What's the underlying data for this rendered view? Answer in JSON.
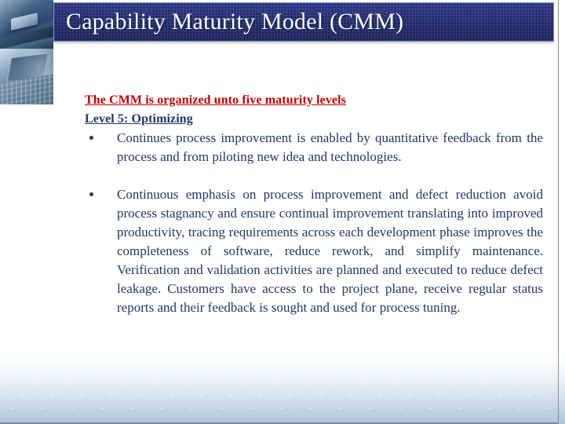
{
  "slide": {
    "title": "Capability Maturity Model (CMM)",
    "title_color": "#FFFFFF",
    "title_bar_color": "#26307A",
    "background_color": "#FFFFFF"
  },
  "content": {
    "lead_heading": "The CMM is organized unto five maturity levels",
    "lead_heading_color": "#C00000",
    "level_heading": "Level 5: Optimizing",
    "level_heading_color": "#1F3864",
    "body_color": "#1F3864",
    "bullets": [
      {
        "marker": "•",
        "text": "Continues process improvement is enabled by quantitative feedback from the process and from piloting new idea and technologies."
      },
      {
        "marker": "•",
        "text": "Continuous emphasis   on process improvement and defect reduction avoid process stagnancy and ensure continual improvement translating into improved productivity, tracing requirements across each development phase improves the completeness of software, reduce rework, and simplify maintenance. Verification and validation  activities are planned and executed to reduce defect leakage. Customers have access to the project plane, receive regular status reports and their feedback is sought and used for process tuning."
      }
    ]
  },
  "decoration": {
    "left_top_image": "keyboard-key-photo",
    "left_bottom_image": "laptop-photo",
    "bottom_band": "keyboard-texture-gradient"
  }
}
